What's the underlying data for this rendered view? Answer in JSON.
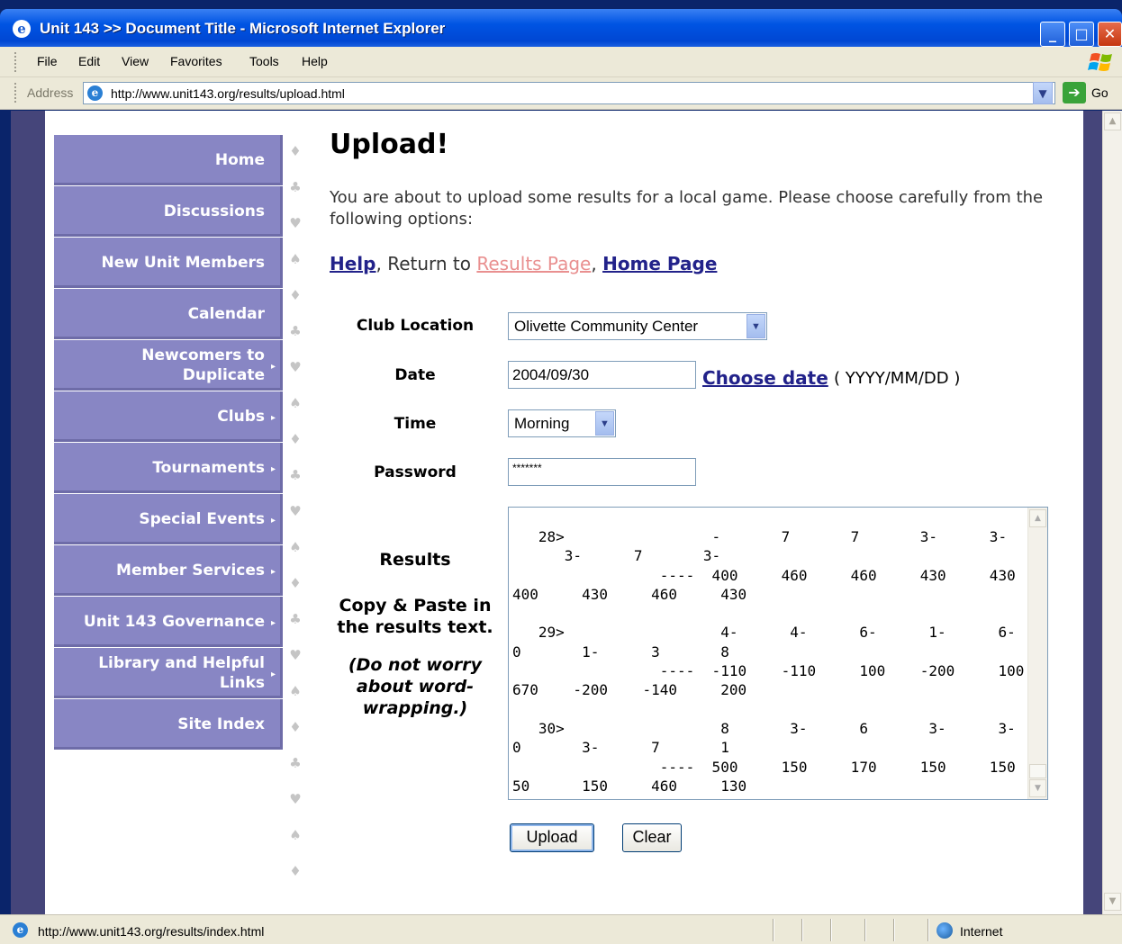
{
  "window": {
    "title": "Unit 143 >> Document Title - Microsoft Internet Explorer",
    "min": "_",
    "max": "□",
    "close": "✕"
  },
  "menu": [
    "File",
    "Edit",
    "View",
    "Favorites",
    "Tools",
    "Help"
  ],
  "address": {
    "label": "Address",
    "url": "http://www.unit143.org/results/upload.html",
    "go": "Go"
  },
  "nav": [
    {
      "label": "Home",
      "submenu": false
    },
    {
      "label": "Discussions",
      "submenu": false
    },
    {
      "label": "New Unit Members",
      "submenu": false
    },
    {
      "label": "Calendar",
      "submenu": false
    },
    {
      "label": "Newcomers to Duplicate",
      "submenu": true
    },
    {
      "label": "Clubs",
      "submenu": true
    },
    {
      "label": "Tournaments",
      "submenu": true
    },
    {
      "label": "Special Events",
      "submenu": true
    },
    {
      "label": "Member Services",
      "submenu": true
    },
    {
      "label": "Unit 143 Governance",
      "submenu": true
    },
    {
      "label": "Library and Helpful Links",
      "submenu": true
    },
    {
      "label": "Site Index",
      "submenu": false
    }
  ],
  "page": {
    "heading": "Upload!",
    "intro": "You are about to upload some results for a local game. Please choose carefully from the following options:",
    "links": {
      "help": "Help",
      "return_text": ", Return to ",
      "results": "Results Page",
      "sep": ", ",
      "home": "Home Page"
    }
  },
  "form": {
    "club_label": "Club Location",
    "club_value": "Olivette Community Center",
    "date_label": "Date",
    "date_value": "2004/09/30",
    "choose_date": "Choose date",
    "date_format": "( YYYY/MM/DD )",
    "time_label": "Time",
    "time_value": "Morning",
    "password_label": "Password",
    "password_value": "*******",
    "results_label": "Results",
    "results_instr": "Copy & Paste in the results text.",
    "results_note": "(Do not worry about word-wrapping.)",
    "results_text": "   28>                 -       7       7       3-      3-       -\n      3-      7       3-\n                 ----  400     460     460     430     430\n400     430     460     430\n\n   29>                  4-      4-      6-      1-      6-\n0       1-      3       8\n                 ----  -110    -110     100    -200     100    -\n670    -200    -140     200\n\n   30>                  8       3-      6       3-      3-\n0       3-      7       1\n                 ----  500     150     170     150     150     -\n50      150     460     130",
    "upload_btn": "Upload",
    "clear_btn": "Clear"
  },
  "status": {
    "url": "http://www.unit143.org/results/index.html",
    "zone": "Internet"
  }
}
